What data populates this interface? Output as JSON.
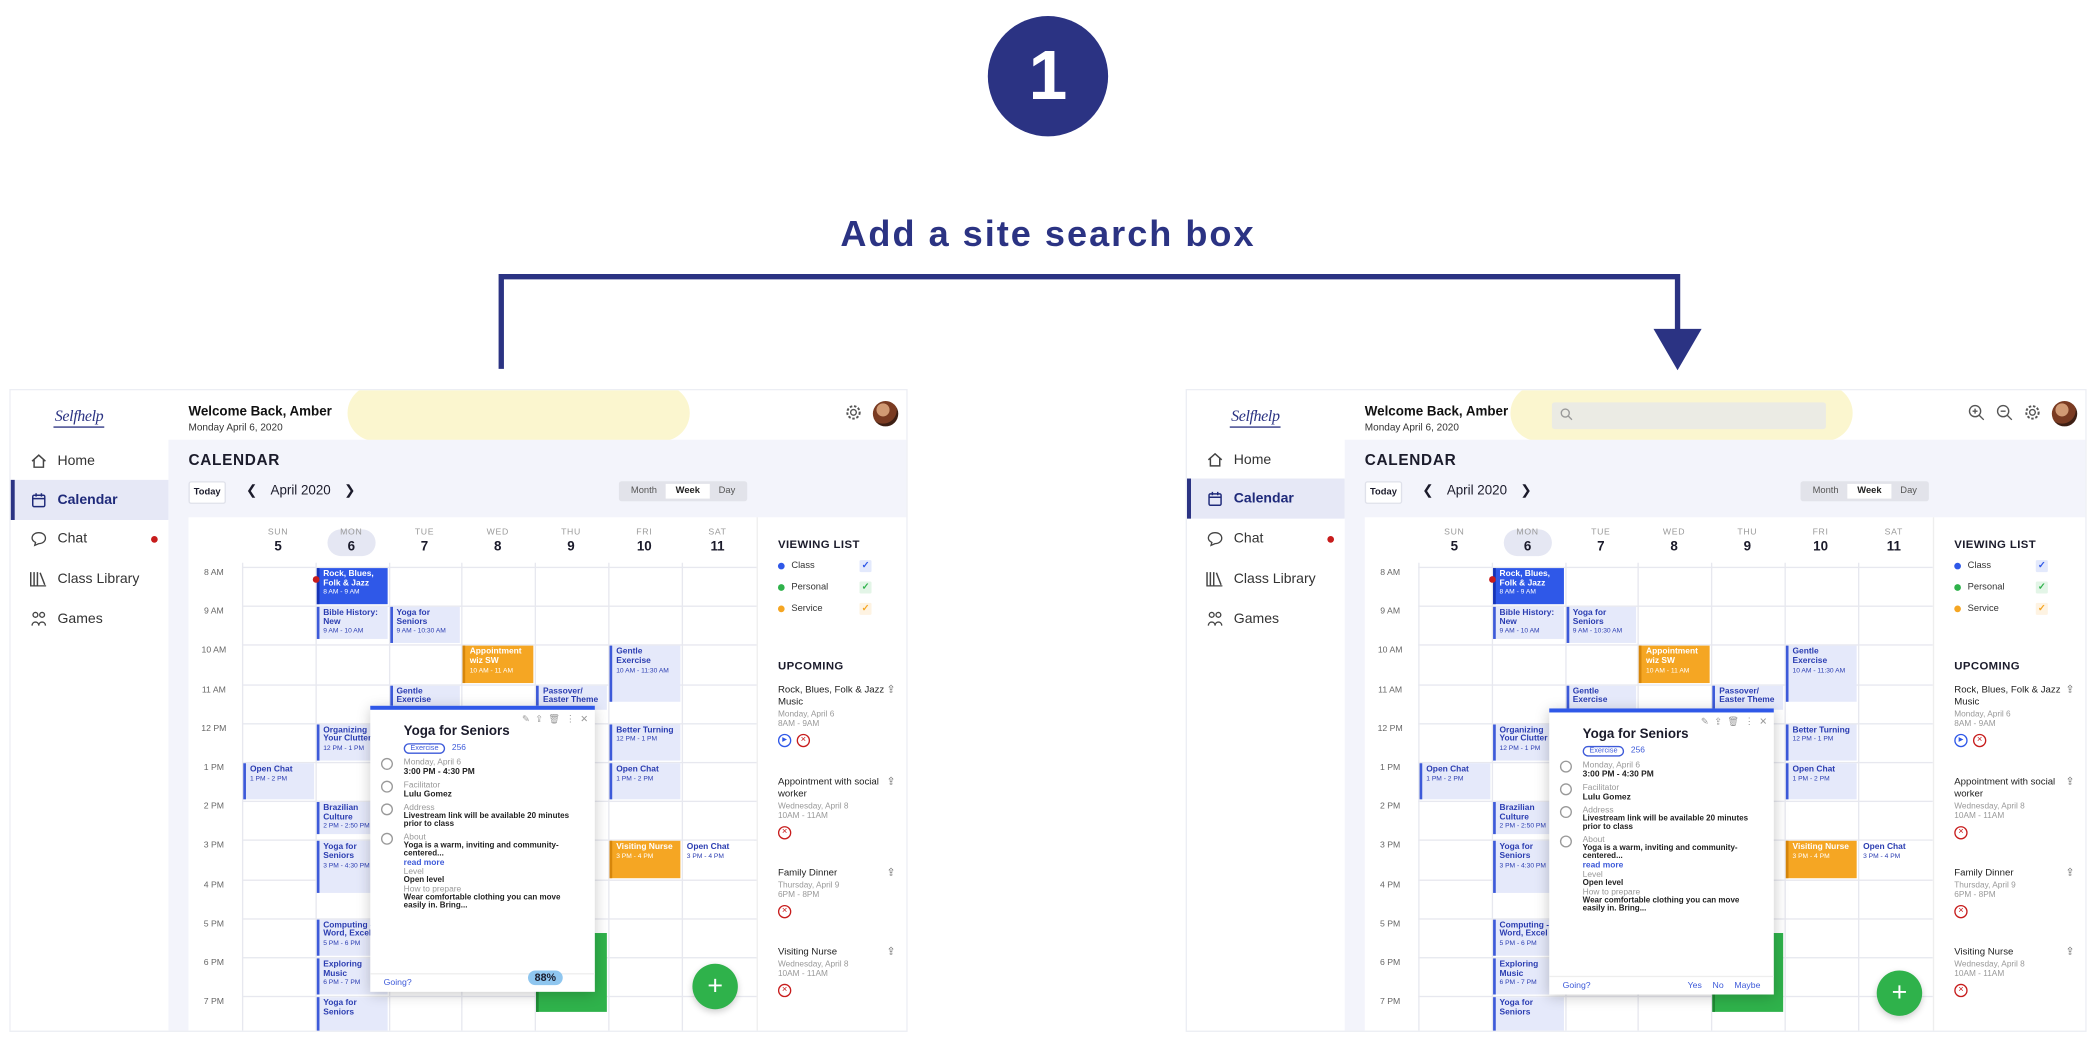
{
  "step": {
    "number": "1",
    "title": "Add a site search box"
  },
  "brand": {
    "logo": "Selfhelp",
    "accent": "#2b3383",
    "highlight": "#fbf6cf"
  },
  "nav": [
    {
      "label": "Home",
      "icon": "home-icon"
    },
    {
      "label": "Calendar",
      "icon": "calendar-icon",
      "active": true
    },
    {
      "label": "Chat",
      "icon": "chat-icon",
      "unread": true
    },
    {
      "label": "Class Library",
      "icon": "library-icon"
    },
    {
      "label": "Games",
      "icon": "games-icon"
    }
  ],
  "header": {
    "welcome": "Welcome Back, Amber",
    "date": "Monday April 6, 2020"
  },
  "calendar": {
    "heading": "CALENDAR",
    "today_label": "Today",
    "month_label": "April 2020",
    "views": [
      "Month",
      "Week",
      "Day"
    ],
    "selected_view": "Week",
    "days": [
      {
        "name": "SUN",
        "num": "5"
      },
      {
        "name": "MON",
        "num": "6"
      },
      {
        "name": "TUE",
        "num": "7"
      },
      {
        "name": "WED",
        "num": "8"
      },
      {
        "name": "THU",
        "num": "9"
      },
      {
        "name": "FRI",
        "num": "10"
      },
      {
        "name": "SAT",
        "num": "11"
      }
    ],
    "times": [
      "8 AM",
      "9 AM",
      "10 AM",
      "11 AM",
      "12 PM",
      "1 PM",
      "2 PM",
      "3 PM",
      "4 PM",
      "5 PM",
      "6 PM",
      "7 PM"
    ],
    "events": [
      {
        "title": "Rock, Blues, Folk & Jazz",
        "time": "8 AM - 9 AM",
        "color": "blue"
      },
      {
        "title": "Bible History: New",
        "time": "9 AM - 10 AM",
        "color": "light"
      },
      {
        "title": "Yoga for Seniors",
        "time": "9 AM - 10:30 AM",
        "color": "light"
      },
      {
        "title": "Appointment wiz SW",
        "time": "10 AM - 11 AM",
        "color": "orange"
      },
      {
        "title": "Gentle Exercise",
        "time": "10 AM - 11:30 AM",
        "color": "light"
      },
      {
        "title": "Gentle Exercise",
        "time": "",
        "color": "light"
      },
      {
        "title": "Passover/ Easter Theme",
        "time": "",
        "color": "light"
      },
      {
        "title": "Organizing Your Clutter",
        "time": "12 PM - 1 PM",
        "color": "light"
      },
      {
        "title": "Better Turning",
        "time": "12 PM - 1 PM",
        "color": "light"
      },
      {
        "title": "Open Chat",
        "time": "1 PM - 2 PM",
        "color": "light"
      },
      {
        "title": "Open Chat",
        "time": "1 PM - 2 PM",
        "color": "light"
      },
      {
        "title": "Brazilian Culture",
        "time": "2 PM - 2:50 PM",
        "color": "light"
      },
      {
        "title": "Yoga for Seniors",
        "time": "3 PM - 4:30 PM",
        "color": "light"
      },
      {
        "title": "Visiting Nurse",
        "time": "3 PM - 4 PM",
        "color": "orange"
      },
      {
        "title": "Open Chat",
        "time": "3 PM - 4 PM",
        "color": "plain"
      },
      {
        "title": "Computing - Word, Excel",
        "time": "5 PM - 6 PM",
        "color": "light"
      },
      {
        "title": "Exploring Music",
        "time": "6 PM - 7 PM",
        "color": "light"
      },
      {
        "title": "Yoga for Seniors",
        "time": "",
        "color": "light"
      }
    ]
  },
  "popup": {
    "title": "Yoga for Seniors",
    "tag": "Exercise",
    "likes": "256",
    "date": "Monday, April 6",
    "time": "3:00 PM - 4:30 PM",
    "facilitator_label": "Facilitator",
    "facilitator": "Lulu Gomez",
    "address_label": "Address",
    "address": "Livestream link will be available 20 minutes prior to class",
    "about_label": "About",
    "about": "Yoga is a warm, inviting and community-centered...",
    "read_more": "read more",
    "level_label": "Level",
    "level": "Open level",
    "prepare_label": "How to prepare",
    "prepare": "Wear comfortable clothing you can move easily in. Bring...",
    "going": "Going?",
    "yes": "Yes",
    "no": "No",
    "maybe": "Maybe",
    "overlay_pct": "88%"
  },
  "viewing_list": {
    "heading": "VIEWING LIST",
    "items": [
      {
        "label": "Class",
        "color": "#2f58e8"
      },
      {
        "label": "Personal",
        "color": "#2fb24b"
      },
      {
        "label": "Service",
        "color": "#f5a623"
      }
    ]
  },
  "upcoming": {
    "heading": "UPCOMING",
    "items": [
      {
        "title": "Rock, Blues, Folk & Jazz Music",
        "date": "Monday, April 6",
        "time": "8AM - 9AM"
      },
      {
        "title": "Appointment with social worker",
        "date": "Wednesday, April 8",
        "time": "10AM - 11AM"
      },
      {
        "title": "Family Dinner",
        "date": "Thursday, April 9",
        "time": "6PM - 8PM"
      },
      {
        "title": "Visiting Nurse",
        "date": "Wednesday, April 8",
        "time": "10AM - 11AM"
      }
    ]
  },
  "fab_label": "+"
}
